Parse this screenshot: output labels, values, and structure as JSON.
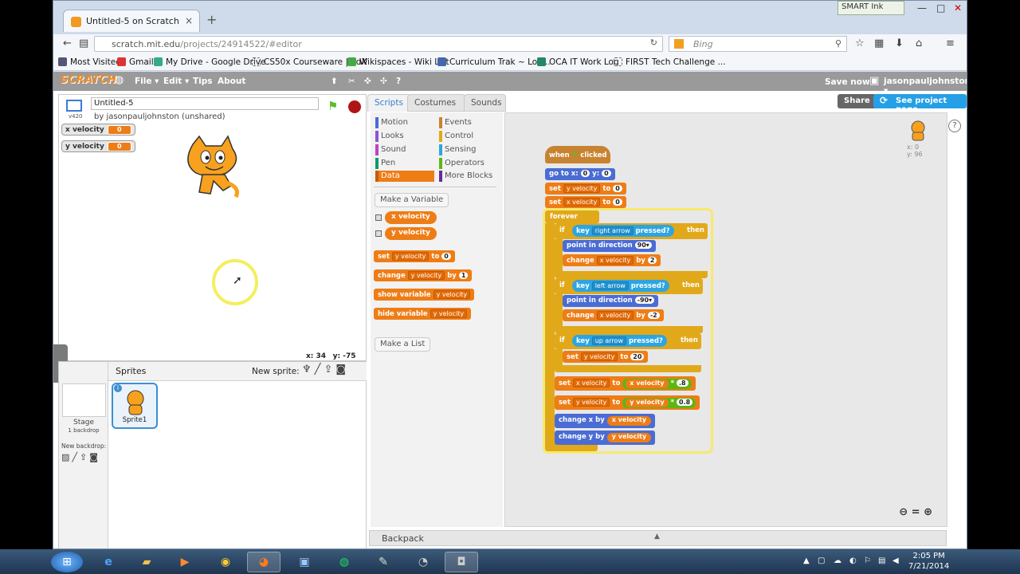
{
  "browser": {
    "tab_title": "Untitled-5 on Scratch",
    "url_host": "scratch.mit.edu",
    "url_path": "/projects/24914522/#editor",
    "search_placeholder": "Bing",
    "smart_ink": "SMART Ink"
  },
  "bookmarks": [
    "Most Visited",
    "Gmail",
    "My Drive - Google Drive",
    "CS50x Courseware | edX",
    "Wikispaces - Wiki List",
    "Curriculum Trak ~ Log...",
    "OCA IT Work Log",
    "FIRST Tech Challenge ..."
  ],
  "scratch_menu": {
    "logo": "SCRATCH",
    "file": "File ▾",
    "edit": "Edit ▾",
    "tips": "Tips",
    "about": "About",
    "save_now": "Save now",
    "user": "jasonpauljohnston ▾"
  },
  "project": {
    "title": "Untitled-5",
    "by": "by jasonpauljohnston (unshared)",
    "version": "v420"
  },
  "monitors": [
    {
      "name": "x velocity",
      "value": "0"
    },
    {
      "name": "y velocity",
      "value": "0"
    }
  ],
  "stage_coords": {
    "x": "x: 34",
    "y": "y: -75"
  },
  "sprites_panel": {
    "title": "Sprites",
    "new_sprite": "New sprite:",
    "stage_label": "Stage",
    "stage_backdrops": "1 backdrop",
    "new_backdrop": "New backdrop:",
    "sprite_name": "Sprite1"
  },
  "editor_tabs": [
    "Scripts",
    "Costumes",
    "Sounds"
  ],
  "header_buttons": {
    "share": "Share",
    "see_project": "See project page"
  },
  "categories": {
    "left": [
      "Motion",
      "Looks",
      "Sound",
      "Pen",
      "Data"
    ],
    "right": [
      "Events",
      "Control",
      "Sensing",
      "Operators",
      "More Blocks"
    ],
    "colors": {
      "Motion": "#4a6cd4",
      "Looks": "#8a55d7",
      "Sound": "#bb42c3",
      "Pen": "#0e9a6c",
      "Data": "#ee7d16",
      "Events": "#c88330",
      "Control": "#e1a91a",
      "Sensing": "#2ca5e2",
      "Operators": "#5cb712",
      "More Blocks": "#632d99"
    }
  },
  "palette": {
    "make_variable": "Make a Variable",
    "vars": [
      "x velocity",
      "y velocity"
    ],
    "set": "set",
    "set_var": "y velocity",
    "to": "to",
    "set_val": "0",
    "change": "change",
    "change_var": "y velocity",
    "by": "by",
    "change_val": "1",
    "show": "show variable",
    "show_var": "y velocity",
    "hide": "hide variable",
    "hide_var": "y velocity",
    "make_list": "Make a List"
  },
  "script": {
    "when": "when",
    "clicked": "clicked",
    "goto": "go to x:",
    "goto_x": "0",
    "goto_y_label": "y:",
    "goto_y": "0",
    "set": "set",
    "to": "to",
    "change": "change",
    "by": "by",
    "yv": "y velocity",
    "xv": "x velocity",
    "zero": "0",
    "forever": "forever",
    "if": "if",
    "then": "then",
    "key": "key",
    "pressed": "pressed?",
    "right_arrow": "right arrow",
    "left_arrow": "left arrow",
    "up_arrow": "up arrow",
    "point": "point in direction",
    "dir90": "90▾",
    "dirm90": "-90▾",
    "two": "2",
    "neg2": "-2",
    "twenty": "20",
    "times": "*",
    "p8": ".8",
    "p08": "0.8",
    "change_x": "change x by",
    "change_y": "change y by"
  },
  "sprite_info": {
    "x": "x: 0",
    "y": "y: 96"
  },
  "backpack": "Backpack",
  "clock": {
    "time": "2:05 PM",
    "date": "7/21/2014"
  }
}
